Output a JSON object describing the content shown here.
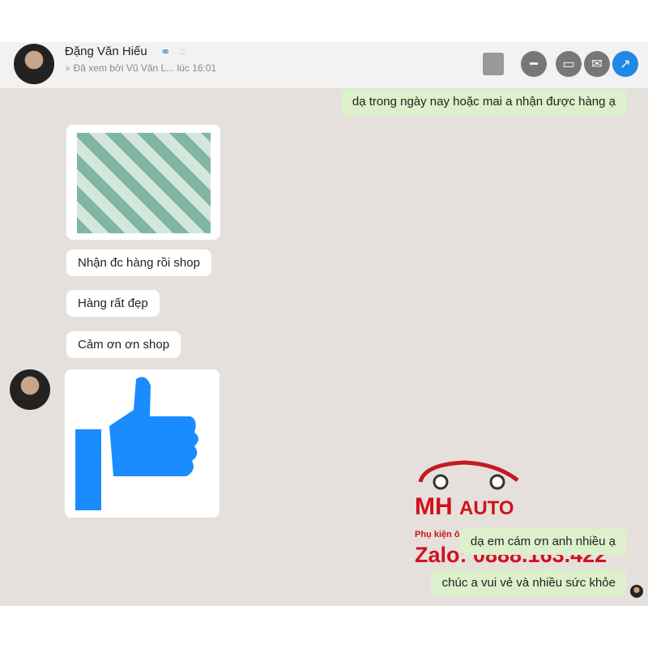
{
  "header": {
    "name": "Đặng Văn Hiếu",
    "seen": "Đã xem bởi Vũ Văn L... lúc 16:01",
    "icons": [
      "contact-card-icon",
      "minus-icon",
      "inbox-icon",
      "mail-icon",
      "open-external-icon"
    ]
  },
  "messages": [
    {
      "side": "me",
      "text": "dạ trong ngày nay hoặc mai a nhận được hàng ạ"
    },
    {
      "side": "them",
      "type": "image"
    },
    {
      "side": "them",
      "text": "Nhận đc hàng rồi shop"
    },
    {
      "side": "them",
      "text": "Hàng rất đẹp"
    },
    {
      "side": "them",
      "text": "Cảm ơn ơn shop"
    },
    {
      "side": "them",
      "type": "like"
    },
    {
      "side": "me",
      "text": "dạ em cám ơn anh nhiều ạ"
    },
    {
      "side": "me",
      "text": "chúc a vui vẻ và nhiều sức khỏe"
    }
  ],
  "watermark": {
    "brand1": "MH",
    "brand2": "AUTO",
    "tagline": "Phụ kiện ô tô đẳng cấp",
    "zalo": "Zalo: 0888.163.422",
    "color": "#d0121b"
  },
  "colors": {
    "accent": "#1e88e5",
    "my_bubble": "#dcf0cc",
    "chat_bg": "#e6e0dc"
  }
}
